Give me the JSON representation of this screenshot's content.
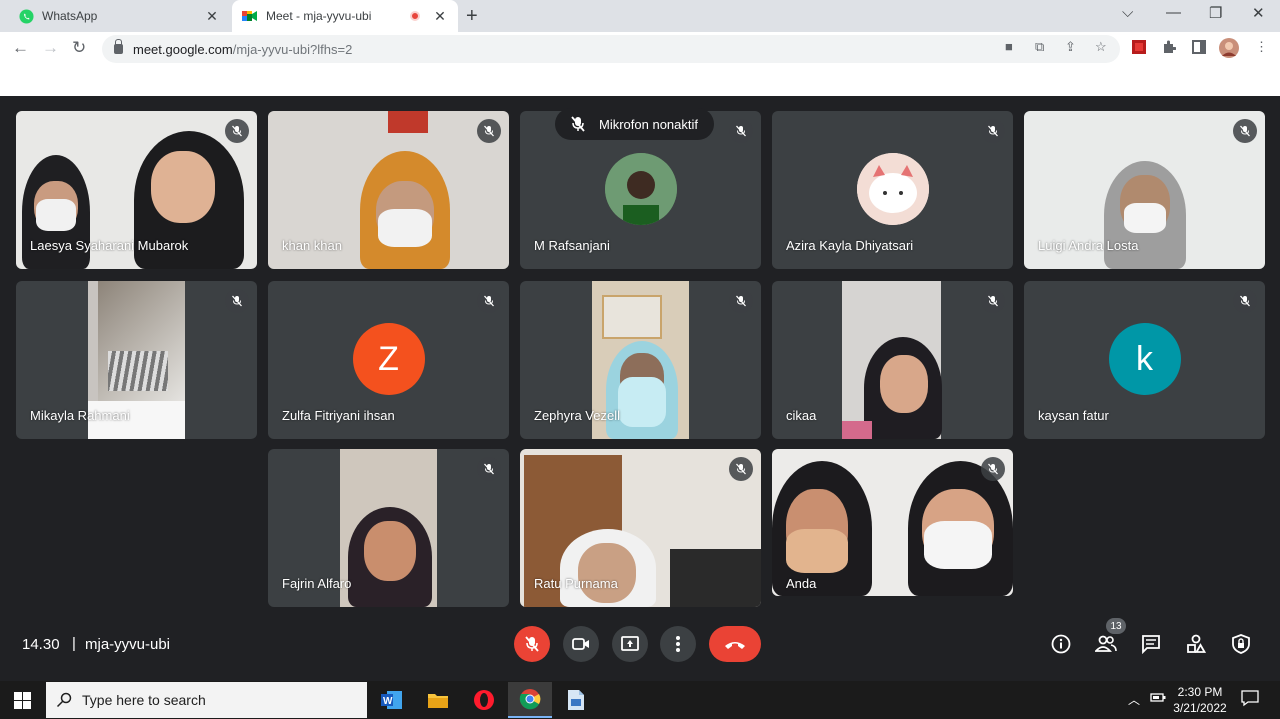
{
  "browser": {
    "tabs": [
      {
        "title": "WhatsApp",
        "active": false
      },
      {
        "title": "Meet - mja-yyvu-ubi",
        "active": true,
        "recording": true
      }
    ],
    "new_tab_label": "+",
    "url_domain": "meet.google.com",
    "url_path": "/mja-yyvu-ubi?lfhs=2"
  },
  "toast": {
    "text": "Mikrofon nonaktif"
  },
  "participants": [
    {
      "name": "Laesya Syaharani Mubarok",
      "type": "video"
    },
    {
      "name": "khan khan",
      "type": "video"
    },
    {
      "name": "M Rafsanjani",
      "type": "avatar-photo"
    },
    {
      "name": "Azira Kayla Dhiyatsari",
      "type": "avatar-photo"
    },
    {
      "name": "Luigi Andra Losta",
      "type": "video"
    },
    {
      "name": "Mikayla Rahmani",
      "type": "video"
    },
    {
      "name": "Zulfa Fitriyani ihsan",
      "type": "avatar-letter",
      "letter": "Z",
      "color": "#f4511e"
    },
    {
      "name": "Zephyra Vezell",
      "type": "video"
    },
    {
      "name": "cikaa",
      "type": "video"
    },
    {
      "name": "kaysan fatur",
      "type": "avatar-letter",
      "letter": "k",
      "color": "#0097a7"
    },
    {
      "name": "Fajrin Alfaro",
      "type": "video"
    },
    {
      "name": "Ratu Purnama",
      "type": "video"
    },
    {
      "name": "Anda",
      "type": "video"
    }
  ],
  "meeting": {
    "time": "14.30",
    "separator": "|",
    "code": "mja-yyvu-ubi",
    "participant_count": "13"
  },
  "controls": {
    "mic": "mic-off",
    "camera": "camera",
    "present": "present",
    "more": "more",
    "leave": "leave"
  },
  "colors": {
    "meet_bg": "#202124",
    "tile_bg": "#3c4043",
    "danger": "#ea4335"
  },
  "taskbar": {
    "search_placeholder": "Type here to search",
    "time": "2:30 PM",
    "date": "3/21/2022"
  }
}
